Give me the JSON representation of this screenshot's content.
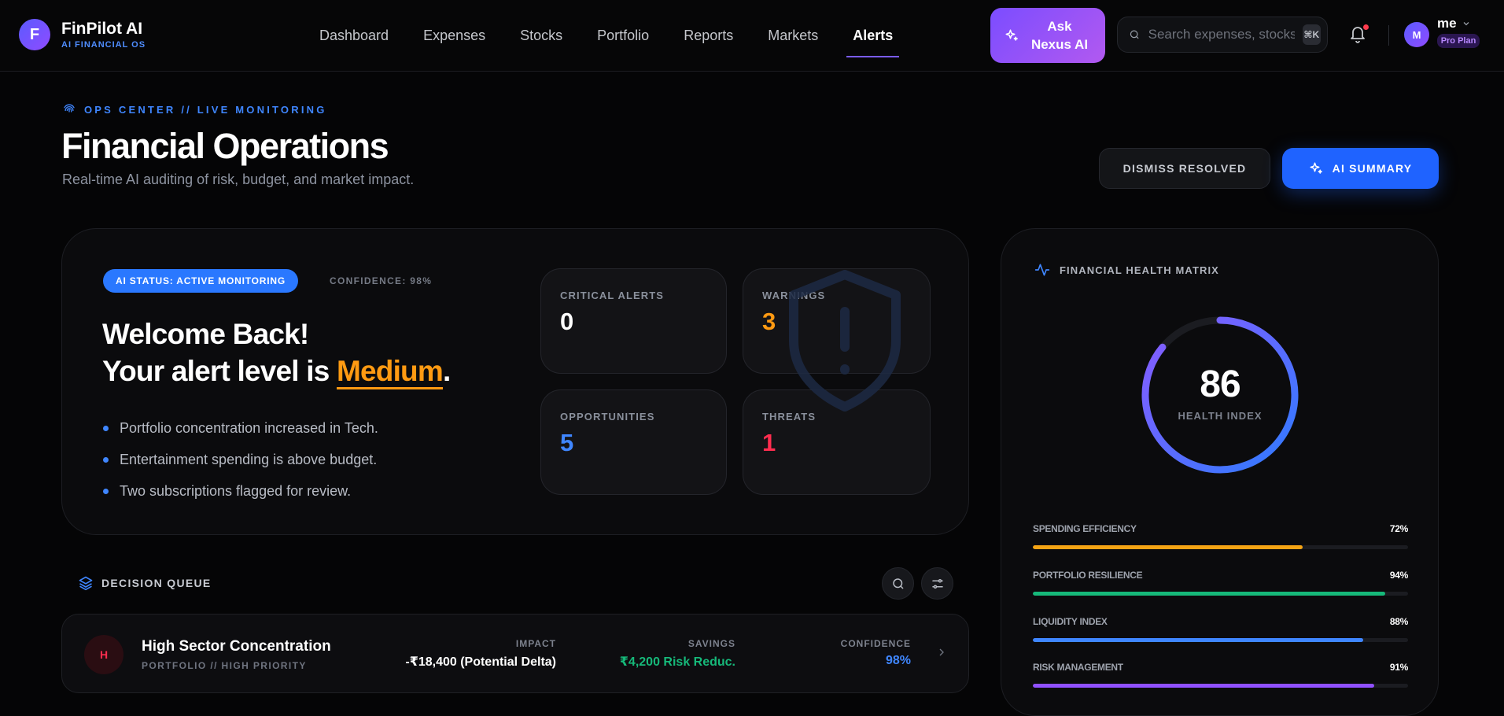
{
  "brand": {
    "logo_letter": "F",
    "name": "FinPilot AI",
    "tagline": "AI FINANCIAL OS"
  },
  "nav": {
    "links": [
      "Dashboard",
      "Expenses",
      "Stocks",
      "Portfolio",
      "Reports",
      "Markets",
      "Alerts"
    ],
    "active": "Alerts",
    "ask_button": "Ask Nexus AI",
    "search_placeholder": "Search expenses, stocks...",
    "search_shortcut": "⌘K",
    "notification_indicator": true
  },
  "user": {
    "avatar_letter": "M",
    "name": "me",
    "plan": "Pro Plan"
  },
  "header": {
    "eyebrow": "OPS CENTER // LIVE MONITORING",
    "title": "Financial Operations",
    "subtitle": "Real-time AI auditing of risk, budget, and market impact.",
    "dismiss_button": "DISMISS RESOLVED",
    "summary_button": "AI SUMMARY"
  },
  "hero": {
    "status_pill": "AI STATUS: ACTIVE MONITORING",
    "confidence": "CONFIDENCE: 98%",
    "welcome_line1": "Welcome Back!",
    "welcome_line2_prefix": "Your alert level is ",
    "alert_level": "Medium",
    "welcome_line2_suffix": ".",
    "bullets": [
      "Portfolio concentration increased in Tech.",
      "Entertainment spending is above budget.",
      "Two subscriptions flagged for review."
    ],
    "stats": [
      {
        "label": "CRITICAL ALERTS",
        "value": "0",
        "color": "#ffffff"
      },
      {
        "label": "WARNINGS",
        "value": "3",
        "color": "#ff9a12"
      },
      {
        "label": "OPPORTUNITIES",
        "value": "5",
        "color": "#3f86ff"
      },
      {
        "label": "THREATS",
        "value": "1",
        "color": "#ff2d4f"
      }
    ]
  },
  "decision_queue": {
    "title": "DECISION QUEUE",
    "items": [
      {
        "badge": "H",
        "title": "High Sector Concentration",
        "subtitle": "PORTFOLIO // HIGH PRIORITY",
        "impact_label": "IMPACT",
        "impact_value": "-₹18,400 (Potential Delta)",
        "savings_label": "SAVINGS",
        "savings_value": "₹4,200 Risk Reduc.",
        "confidence_label": "CONFIDENCE",
        "confidence_value": "98%"
      }
    ]
  },
  "health_matrix": {
    "title": "FINANCIAL HEALTH MATRIX",
    "index_value": 86,
    "index_label": "HEALTH INDEX",
    "metrics": [
      {
        "label": "SPENDING EFFICIENCY",
        "percent": 72,
        "display": "72%",
        "color": "#f5a414"
      },
      {
        "label": "PORTFOLIO RESILIENCE",
        "percent": 94,
        "display": "94%",
        "color": "#16b97a"
      },
      {
        "label": "LIQUIDITY INDEX",
        "percent": 88,
        "display": "88%",
        "color": "#3f86ff"
      },
      {
        "label": "RISK MANAGEMENT",
        "percent": 91,
        "display": "91%",
        "color": "#9050ff"
      }
    ]
  }
}
